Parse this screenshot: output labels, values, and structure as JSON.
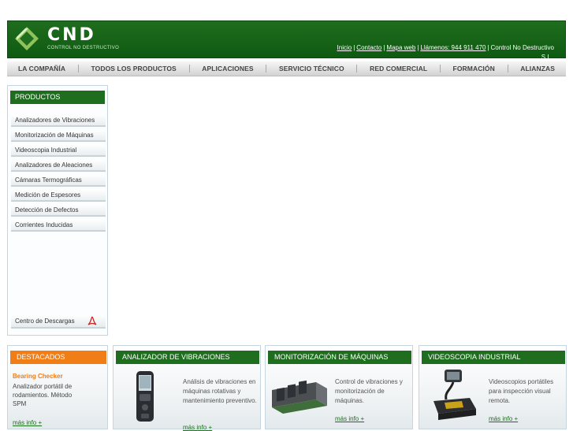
{
  "brand": {
    "name": "CND",
    "subtitle": "CONTROL NO DESTRUCTIVO",
    "primary_color": "#1f6d1e",
    "accent_color": "#f07d16"
  },
  "top_links": {
    "inicio": "Inicio",
    "contacto": "Contacto",
    "mapa": "Mapa web",
    "llamenos": "Llámenos: 944 911 470",
    "company": "Control No Destructivo",
    "company_tail": "S.L."
  },
  "nav": [
    "LA COMPAÑÍA",
    "TODOS LOS PRODUCTOS",
    "APLICACIONES",
    "SERVICIO TÉCNICO",
    "RED COMERCIAL",
    "FORMACIÓN",
    "ALIANZAS"
  ],
  "sidebar": {
    "title": "PRODUCTOS",
    "items": [
      "Analizadores de Vibraciones",
      "Monitorización de Máquinas",
      "Videoscopia Industrial",
      "Analizadores de Aleaciones",
      "Cámaras Termográficas",
      "Medición de Espesores",
      "Detección de Defectos",
      "Corrientes Inducidas"
    ],
    "download": "Centro de Descargas"
  },
  "featured": {
    "title": "DESTACADOS",
    "product": "Bearing Checker",
    "description": "Analizador portátil de rodamientos. Método SPM",
    "more": "más info +"
  },
  "products": [
    {
      "title": "ANALIZADOR DE VIBRACIONES",
      "description": "Análisis de vibraciones en máquinas rotativas y mantenimiento preventivo.",
      "more": "más info +",
      "icon": "handheld-analyzer-icon"
    },
    {
      "title": "MONITORIZACIÓN DE MÁQUINAS",
      "description": "Control de vibraciones y monitorización de máquinas.",
      "more": "más info +",
      "icon": "monitoring-module-icon"
    },
    {
      "title": "VIDEOSCOPIA INDUSTRIAL",
      "description": "Videoscopios portátiles para inspección visual remota.",
      "more": "más info +",
      "icon": "videoscope-icon"
    }
  ]
}
